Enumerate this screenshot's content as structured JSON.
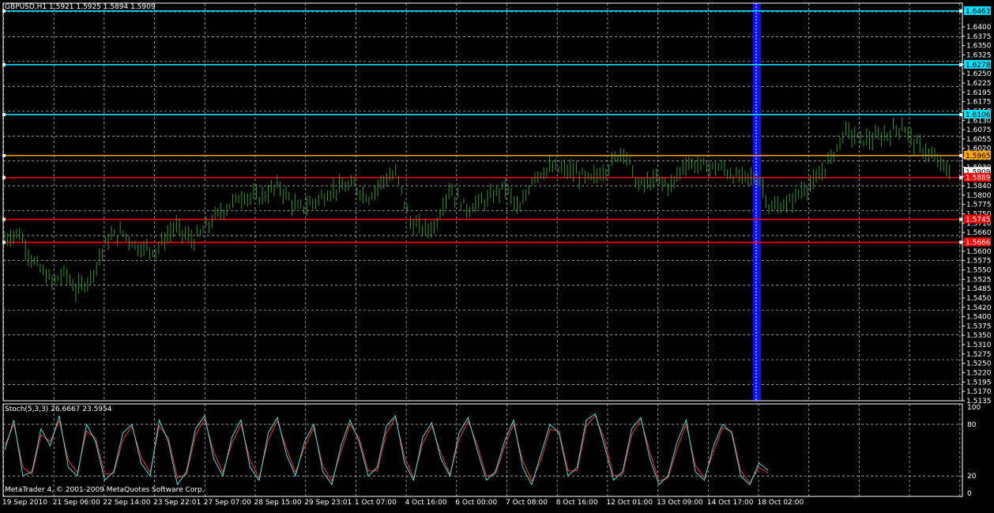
{
  "window": {
    "symbol_info": "GBPUSD,H1  1.5921 1.5925 1.5894 1.5909",
    "indicator_info": "Stoch(5,3,3) 26.6667 23.5954",
    "copyright": "MetaTrader 4, © 2001-2009 MetaQuotes Software Corp."
  },
  "colors": {
    "background": "#000000",
    "grid": "#b0b0b0",
    "bull_bar": "#2a9a2a",
    "line_cyan": "#00e0ff",
    "line_orange": "#ffa500",
    "line_red": "#ff0000",
    "selection": "#1010ff",
    "stoch_main": "#40e0e0",
    "stoch_signal": "#ff3030"
  },
  "price_axis": {
    "ticks": [
      "1.6400",
      "1.6375",
      "1.6350",
      "1.6325",
      "1.6285",
      "1.6250",
      "1.6225",
      "1.6195",
      "1.6175",
      "1.6150",
      "1.6130",
      "1.6075",
      "1.6055",
      "1.6020",
      "1.6000",
      "1.5930",
      "1.5870",
      "1.5840",
      "1.5800",
      "1.5775",
      "1.5750",
      "1.5710",
      "1.5660",
      "1.5625",
      "1.5600",
      "1.5575",
      "1.5550",
      "1.5525",
      "1.5485",
      "1.5450",
      "1.5420",
      "1.5400",
      "1.5375",
      "1.5350",
      "1.5310",
      "1.5275",
      "1.5250",
      "1.5220",
      "1.5195",
      "1.5170",
      "1.5135"
    ],
    "current_price": "1.5909"
  },
  "levels": [
    {
      "price": 1.6463,
      "label": "1.6463",
      "kind": "cyan"
    },
    {
      "price": 1.6278,
      "label": "1.6278",
      "kind": "cyan"
    },
    {
      "price": 1.6106,
      "label": "1.6106",
      "kind": "cyan"
    },
    {
      "price": 1.5965,
      "label": "1.5965",
      "kind": "orange"
    },
    {
      "price": 1.5889,
      "label": "1.5889",
      "kind": "red"
    },
    {
      "price": 1.5745,
      "label": "1.5745",
      "kind": "red"
    },
    {
      "price": 1.5666,
      "label": "1.5666",
      "kind": "red"
    }
  ],
  "stoch_axis": {
    "ticks": [
      {
        "value": 100,
        "label": "100"
      },
      {
        "value": 80,
        "label": "80"
      },
      {
        "value": 20,
        "label": "20"
      },
      {
        "value": 0,
        "label": "0"
      }
    ]
  },
  "time_axis": [
    "19 Sep 2010",
    "21 Sep 06:00",
    "22 Sep 14:00",
    "23 Sep 22:01",
    "27 Sep 07:00",
    "28 Sep 15:00",
    "29 Sep 23:01",
    "1 Oct 07:00",
    "4 Oct 16:00",
    "6 Oct 00:00",
    "7 Oct 08:00",
    "8 Oct 16:00",
    "12 Oct 01:00",
    "13 Oct 09:00",
    "14 Oct 17:00",
    "18 Oct 02:00"
  ],
  "chart_data": {
    "type": "line",
    "price_range": [
      1.512,
      1.649
    ],
    "price_path": [
      [
        0,
        1.568
      ],
      [
        0.015,
        1.57
      ],
      [
        0.03,
        1.56
      ],
      [
        0.05,
        1.553
      ],
      [
        0.065,
        1.556
      ],
      [
        0.075,
        1.55
      ],
      [
        0.09,
        1.554
      ],
      [
        0.11,
        1.568
      ],
      [
        0.125,
        1.57
      ],
      [
        0.14,
        1.565
      ],
      [
        0.16,
        1.564
      ],
      [
        0.18,
        1.572
      ],
      [
        0.2,
        1.567
      ],
      [
        0.225,
        1.576
      ],
      [
        0.25,
        1.5825
      ],
      [
        0.27,
        1.582
      ],
      [
        0.29,
        1.586
      ],
      [
        0.31,
        1.578
      ],
      [
        0.33,
        1.581
      ],
      [
        0.35,
        1.585
      ],
      [
        0.37,
        1.586
      ],
      [
        0.385,
        1.582
      ],
      [
        0.4,
        1.588
      ],
      [
        0.415,
        1.59
      ],
      [
        0.43,
        1.573
      ],
      [
        0.445,
        1.571
      ],
      [
        0.455,
        1.572
      ],
      [
        0.47,
        1.585
      ],
      [
        0.49,
        1.578
      ],
      [
        0.5,
        1.58
      ],
      [
        0.51,
        1.581
      ],
      [
        0.53,
        1.586
      ],
      [
        0.545,
        1.577
      ],
      [
        0.56,
        1.59
      ],
      [
        0.58,
        1.592
      ],
      [
        0.6,
        1.591
      ],
      [
        0.62,
        1.588
      ],
      [
        0.64,
        1.593
      ],
      [
        0.655,
        1.599
      ],
      [
        0.67,
        1.586
      ],
      [
        0.69,
        1.588
      ],
      [
        0.705,
        1.586
      ],
      [
        0.72,
        1.594
      ],
      [
        0.74,
        1.593
      ],
      [
        0.76,
        1.592
      ],
      [
        0.775,
        1.589
      ],
      [
        0.79,
        1.589
      ],
      [
        0.8,
        1.588
      ],
      [
        0.81,
        1.578
      ],
      [
        0.83,
        1.58
      ],
      [
        0.845,
        1.585
      ],
      [
        0.86,
        1.588
      ],
      [
        0.875,
        1.596
      ],
      [
        0.89,
        1.605
      ],
      [
        0.905,
        1.602
      ],
      [
        0.92,
        1.602
      ],
      [
        0.935,
        1.604
      ],
      [
        0.95,
        1.607
      ],
      [
        0.965,
        1.6
      ],
      [
        0.975,
        1.598
      ],
      [
        0.985,
        1.595
      ],
      [
        1.0,
        1.5909
      ]
    ],
    "stoch_main": [
      50,
      85,
      20,
      25,
      75,
      55,
      90,
      30,
      20,
      80,
      60,
      15,
      25,
      70,
      80,
      35,
      20,
      85,
      60,
      10,
      25,
      75,
      90,
      40,
      20,
      65,
      85,
      30,
      15,
      70,
      88,
      45,
      20,
      60,
      80,
      25,
      10,
      55,
      85,
      60,
      20,
      30,
      78,
      90,
      35,
      15,
      65,
      82,
      40,
      20,
      70,
      88,
      50,
      15,
      25,
      60,
      85,
      30,
      10,
      45,
      80,
      70,
      20,
      30,
      85,
      92,
      55,
      15,
      25,
      75,
      88,
      40,
      10,
      20,
      60,
      85,
      25,
      15,
      55,
      80,
      70,
      20,
      10,
      35,
      27
    ],
    "stoch_signal": [
      55,
      80,
      30,
      22,
      68,
      60,
      84,
      38,
      24,
      72,
      64,
      22,
      23,
      62,
      78,
      42,
      24,
      78,
      64,
      18,
      22,
      68,
      86,
      48,
      24,
      58,
      80,
      38,
      18,
      62,
      84,
      52,
      24,
      54,
      76,
      32,
      14,
      48,
      80,
      64,
      26,
      26,
      70,
      88,
      42,
      18,
      58,
      78,
      46,
      22,
      62,
      84,
      56,
      20,
      22,
      54,
      80,
      38,
      14,
      38,
      74,
      72,
      26,
      26,
      78,
      90,
      62,
      20,
      22,
      68,
      86,
      48,
      14,
      18,
      52,
      80,
      32,
      18,
      48,
      76,
      72,
      26,
      12,
      30,
      24
    ]
  }
}
